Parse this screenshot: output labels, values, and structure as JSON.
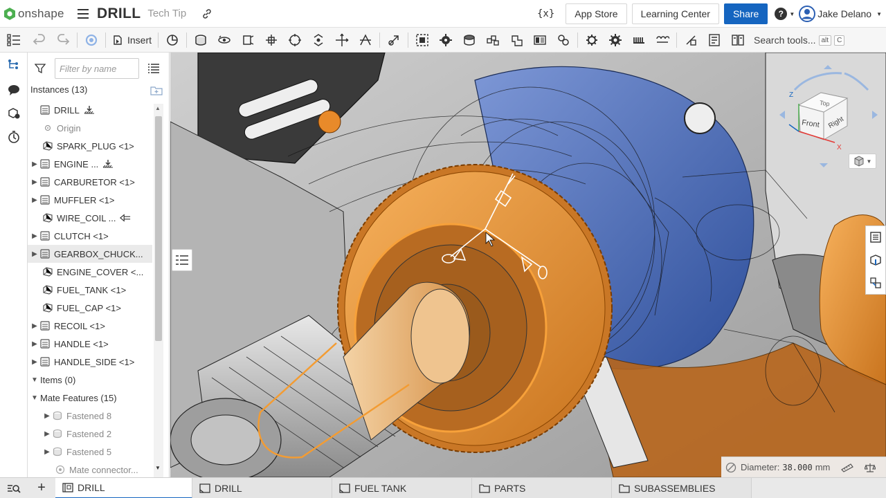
{
  "app": {
    "logo_text": "onshape"
  },
  "document": {
    "title": "DRILL",
    "subtitle": "Tech Tip"
  },
  "topbar": {
    "app_store_label": "App Store",
    "learning_center_label": "Learning Center",
    "share_label": "Share",
    "help_label": "?",
    "user_name": "Jake Delano",
    "vars_label": "{x}"
  },
  "toolbar": {
    "insert_label": "Insert",
    "search_label": "Search tools...",
    "shortcut_alt": "alt",
    "shortcut_key": "C"
  },
  "panel": {
    "filter_placeholder": "Filter by name",
    "instances_header": "Instances (13)",
    "items": [
      {
        "label": "DRILL",
        "caret": "",
        "icon": "assembly-icon",
        "extra": "download-icon",
        "indent": 0
      },
      {
        "label": "Origin",
        "caret": "",
        "icon": "origin-icon",
        "extra": "",
        "indent": 1,
        "dim": true
      },
      {
        "label": "SPARK_PLUG <1>",
        "caret": "",
        "icon": "part-icon",
        "extra": "",
        "indent": 1
      },
      {
        "label": "ENGINE ...",
        "caret": "▶",
        "icon": "assembly-icon",
        "extra": "download-icon",
        "indent": 0
      },
      {
        "label": "CARBURETOR <1>",
        "caret": "▶",
        "icon": "assembly-icon",
        "extra": "",
        "indent": 0
      },
      {
        "label": "MUFFLER <1>",
        "caret": "▶",
        "icon": "assembly-icon",
        "extra": "",
        "indent": 0
      },
      {
        "label": "WIRE_COIL ...",
        "caret": "",
        "icon": "part-icon",
        "extra": "arrow-left-icon",
        "indent": 1
      },
      {
        "label": "CLUTCH <1>",
        "caret": "▶",
        "icon": "assembly-icon",
        "extra": "",
        "indent": 0
      },
      {
        "label": "GEARBOX_CHUCK...",
        "caret": "▶",
        "icon": "assembly-icon",
        "extra": "",
        "indent": 0,
        "selected": true
      },
      {
        "label": "ENGINE_COVER <...",
        "caret": "",
        "icon": "part-icon",
        "extra": "",
        "indent": 1
      },
      {
        "label": "FUEL_TANK <1>",
        "caret": "",
        "icon": "part-icon",
        "extra": "",
        "indent": 1
      },
      {
        "label": "FUEL_CAP <1>",
        "caret": "",
        "icon": "part-icon",
        "extra": "",
        "indent": 1
      },
      {
        "label": "RECOIL <1>",
        "caret": "▶",
        "icon": "assembly-icon",
        "extra": "",
        "indent": 0
      },
      {
        "label": "HANDLE <1>",
        "caret": "▶",
        "icon": "assembly-icon",
        "extra": "",
        "indent": 0
      },
      {
        "label": "HANDLE_SIDE <1>",
        "caret": "▶",
        "icon": "assembly-icon",
        "extra": "",
        "indent": 0
      },
      {
        "label": "Items (0)",
        "caret": "▼",
        "icon": "",
        "extra": "",
        "indent": 0
      },
      {
        "label": "Mate Features (15)",
        "caret": "▼",
        "icon": "",
        "extra": "",
        "indent": 0
      },
      {
        "label": "Fastened 8",
        "caret": "▶",
        "icon": "mate-icon",
        "extra": "",
        "indent": 2,
        "dim": true
      },
      {
        "label": "Fastened 2",
        "caret": "▶",
        "icon": "mate-icon",
        "extra": "",
        "indent": 2,
        "dim": true
      },
      {
        "label": "Fastened 5",
        "caret": "▶",
        "icon": "mate-icon",
        "extra": "",
        "indent": 2,
        "dim": true
      },
      {
        "label": "Mate connector...",
        "caret": "",
        "icon": "mate-connector-icon",
        "extra": "",
        "indent": 3,
        "dim": true
      }
    ]
  },
  "viewcube": {
    "top": "Top",
    "front": "Front",
    "right": "Right",
    "axis_z": "Z",
    "axis_x": "X"
  },
  "measure": {
    "label": "Diameter:",
    "value": "38.000",
    "unit": "mm"
  },
  "tabs": [
    {
      "label": "DRILL",
      "icon": "assembly-tab-icon",
      "active": true
    },
    {
      "label": "DRILL",
      "icon": "partstudio-tab-icon",
      "active": false
    },
    {
      "label": "FUEL TANK",
      "icon": "partstudio-tab-icon",
      "active": false
    },
    {
      "label": "PARTS",
      "icon": "folder-icon",
      "active": false
    },
    {
      "label": "SUBASSEMBLIES",
      "icon": "folder-icon",
      "active": false
    }
  ],
  "colors": {
    "accent": "#1565c0",
    "selection": "#f39c33",
    "highlight_blue": "#4a6fc4"
  }
}
